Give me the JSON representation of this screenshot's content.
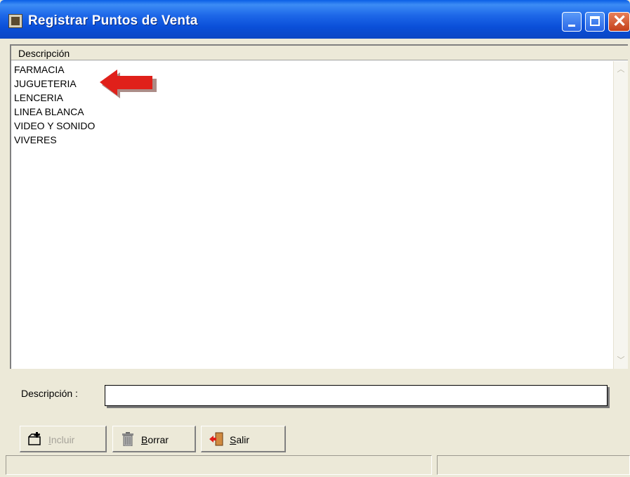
{
  "window": {
    "title": "Registrar Puntos de Venta",
    "icon": "app-icon"
  },
  "grid": {
    "column_header": "Descripción",
    "rows": [
      "FARMACIA",
      "JUGUETERIA",
      "LENCERIA",
      "LINEA BLANCA",
      "VIDEO Y SONIDO",
      "VIVERES"
    ]
  },
  "annotation": {
    "icon": "red-arrow-pointer",
    "color": "#e0201a"
  },
  "form": {
    "description_label": "Descripción :",
    "description_value": ""
  },
  "buttons": {
    "incluir": {
      "prefix": "",
      "accel": "I",
      "rest": "ncluir",
      "icon": "add-record-icon",
      "enabled": false
    },
    "borrar": {
      "prefix": "",
      "accel": "B",
      "rest": "orrar",
      "icon": "trash-icon",
      "enabled": true
    },
    "salir": {
      "prefix": "",
      "accel": "S",
      "rest": "alir",
      "icon": "exit-door-icon",
      "enabled": true
    }
  },
  "status_bar": {
    "panel1": "",
    "panel2": ""
  }
}
